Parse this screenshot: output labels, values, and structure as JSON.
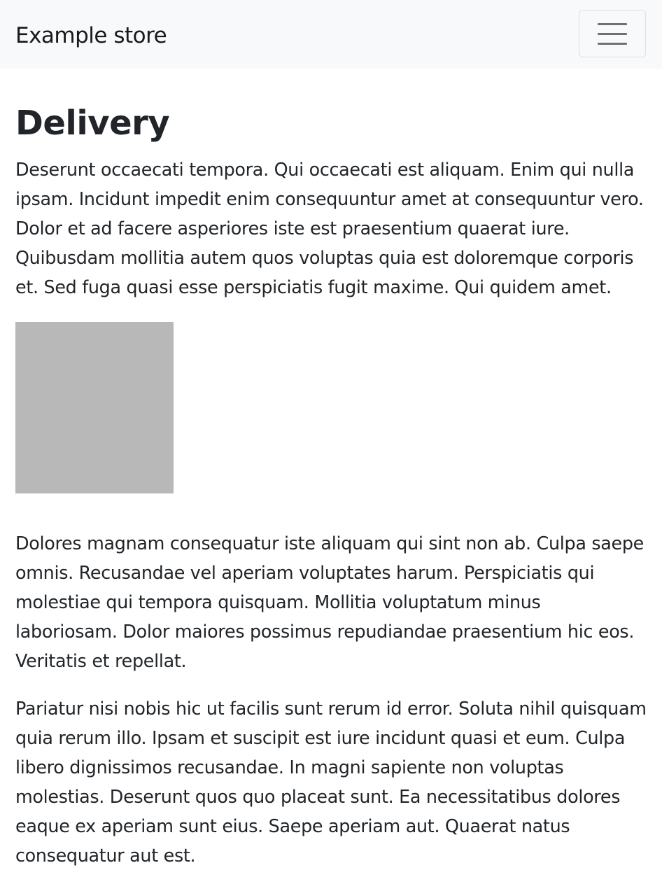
{
  "navbar": {
    "brand": "Example store",
    "toggler_icon": "hamburger-menu-icon"
  },
  "main": {
    "title": "Delivery",
    "paragraphs": [
      "Deserunt occaecati tempora. Qui occaecati est aliquam. Enim qui nulla ipsam. Incidunt impedit enim consequuntur amet at consequuntur vero. Dolor et ad facere asperiores iste est praesentium quaerat iure. Quibusdam mollitia autem quos voluptas quia est doloremque corporis et. Sed fuga quasi esse perspiciatis fugit maxime. Qui quidem amet.",
      "Dolores magnam consequatur iste aliquam qui sint non ab. Culpa saepe omnis. Recusandae vel aperiam voluptates harum. Perspiciatis qui molestiae qui tempora quisquam. Mollitia voluptatum minus laboriosam. Dolor maiores possimus repudiandae praesentium hic eos. Veritatis et repellat.",
      "Pariatur nisi nobis hic ut facilis sunt rerum id error. Soluta nihil quisquam quia rerum illo. Ipsam et suscipit est iure incidunt quasi et eum. Culpa libero dignissimos recusandae. In magni sapiente non voluptas molestias. Deserunt quos quo placeat sunt. Ea necessitatibus dolores eaque ex aperiam sunt eius. Saepe aperiam aut. Quaerat natus consequatur aut est."
    ],
    "image_color": "#b8b8b8"
  },
  "colors": {
    "navbar_bg": "#f8f9fa",
    "text": "#212529"
  }
}
